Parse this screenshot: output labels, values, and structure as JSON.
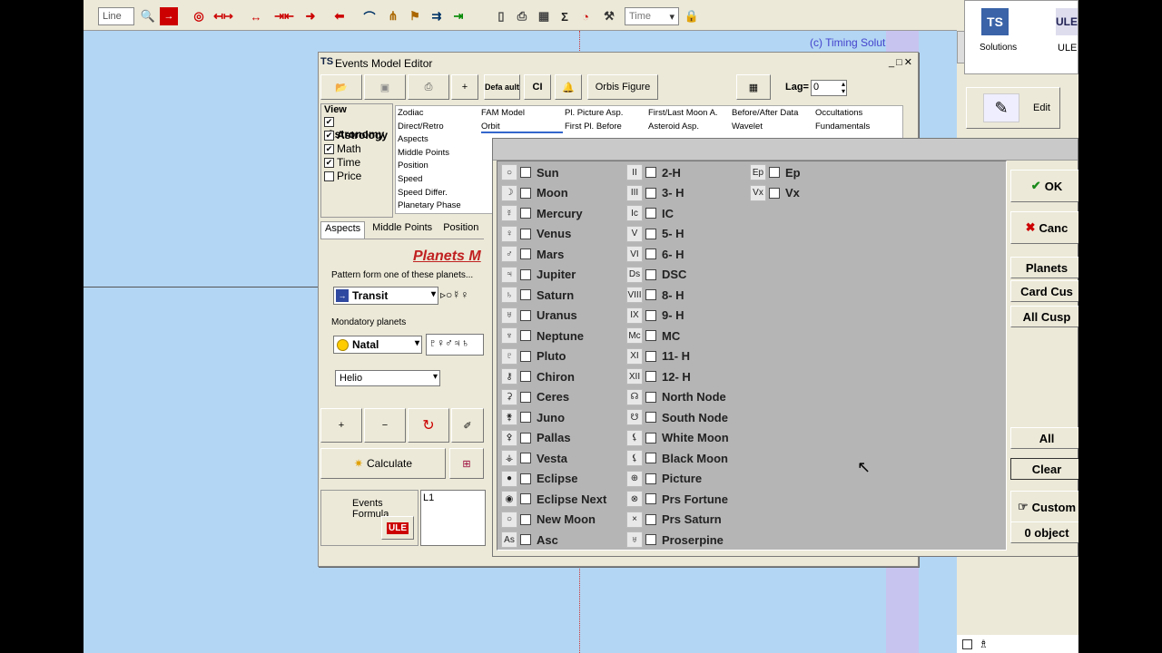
{
  "toolbar": {
    "line_label": "Line",
    "time_label": "Time"
  },
  "copyright": "(c) Timing Solution",
  "right_panel": {
    "solutions": "Solutions",
    "ule": "ULE",
    "edit": "Edit"
  },
  "editor": {
    "title": "Events Model Editor",
    "defa_label": "Defa ault",
    "ci_label": "CI",
    "orbis_label": "Orbis Figure",
    "lag_label": "Lag=",
    "lag_value": "0",
    "view_title": "View",
    "view_items": [
      {
        "label": "Astronomy",
        "checked": true
      },
      {
        "label": "Astrology",
        "checked": true
      },
      {
        "label": "Math",
        "checked": true
      },
      {
        "label": "Time",
        "checked": true
      },
      {
        "label": "Price",
        "checked": false
      }
    ],
    "grid": [
      [
        "Zodiac",
        "FAM Model",
        "Pl. Picture Asp.",
        "First/Last Moon A.",
        "Before/After Data",
        "Occultations"
      ],
      [
        "Direct/Retro",
        "Orbit",
        "First Pl. Before",
        "Asteroid Asp.",
        "Wavelet",
        "Fundamentals"
      ],
      [
        "Aspects"
      ],
      [
        "Middle Points"
      ],
      [
        "Position"
      ],
      [
        "Speed"
      ],
      [
        "Speed Differ."
      ],
      [
        "Planetary Phase"
      ]
    ],
    "tabs": [
      "Aspects",
      "Middle Points",
      "Position"
    ],
    "planets_heading": "Planets M",
    "pattern_label": "Pattern form one of these planets...",
    "transit_value": "Transit",
    "mondatory_label": "Mondatory planets",
    "natal_value": "Natal",
    "helio_value": "Helio",
    "calculate_label": "Calculate",
    "events_formula_label": "Events Formula",
    "formula_value": "L1",
    "ule_label": "ULE"
  },
  "objects": {
    "col1": [
      {
        "sym": "○",
        "label": "Sun"
      },
      {
        "sym": "☽",
        "label": "Moon"
      },
      {
        "sym": "☿",
        "label": "Mercury"
      },
      {
        "sym": "♀",
        "label": "Venus"
      },
      {
        "sym": "♂",
        "label": "Mars"
      },
      {
        "sym": "♃",
        "label": "Jupiter"
      },
      {
        "sym": "♄",
        "label": "Saturn"
      },
      {
        "sym": "♅",
        "label": "Uranus"
      },
      {
        "sym": "♆",
        "label": "Neptune"
      },
      {
        "sym": "♇",
        "label": "Pluto"
      },
      {
        "sym": "⚷",
        "label": "Chiron"
      },
      {
        "sym": "⚳",
        "label": "Ceres"
      },
      {
        "sym": "⚵",
        "label": "Juno"
      },
      {
        "sym": "⚴",
        "label": "Pallas"
      },
      {
        "sym": "⚶",
        "label": "Vesta"
      },
      {
        "sym": "●",
        "label": "Eclipse"
      },
      {
        "sym": "◉",
        "label": "Eclipse Next"
      },
      {
        "sym": "○",
        "label": "New Moon"
      },
      {
        "sym": "As",
        "label": "Asc"
      }
    ],
    "col2": [
      {
        "sym": "II",
        "label": "2-H"
      },
      {
        "sym": "III",
        "label": "3- H"
      },
      {
        "sym": "Ic",
        "label": "IC"
      },
      {
        "sym": "V",
        "label": "5- H"
      },
      {
        "sym": "VI",
        "label": "6- H"
      },
      {
        "sym": "Ds",
        "label": "DSC"
      },
      {
        "sym": "VIII",
        "label": "8- H"
      },
      {
        "sym": "IX",
        "label": "9- H"
      },
      {
        "sym": "Mc",
        "label": "MC"
      },
      {
        "sym": "XI",
        "label": "11- H"
      },
      {
        "sym": "XII",
        "label": "12- H"
      },
      {
        "sym": "☊",
        "label": "North Node"
      },
      {
        "sym": "☋",
        "label": "South Node"
      },
      {
        "sym": "⚸",
        "label": "White Moon"
      },
      {
        "sym": "⚸",
        "label": "Black Moon"
      },
      {
        "sym": "⊕",
        "label": "Picture"
      },
      {
        "sym": "⊗",
        "label": "Prs Fortune"
      },
      {
        "sym": "×",
        "label": "Prs Saturn"
      },
      {
        "sym": "♅",
        "label": "Proserpine"
      }
    ],
    "col3": [
      {
        "sym": "Ep",
        "label": "Ep"
      },
      {
        "sym": "Vx",
        "label": "Vx"
      }
    ],
    "buttons": [
      "OK",
      "Canc",
      "Planets",
      "Card Cus",
      "All Cusp",
      "All",
      "Clear",
      "Custom",
      "0 object"
    ]
  }
}
